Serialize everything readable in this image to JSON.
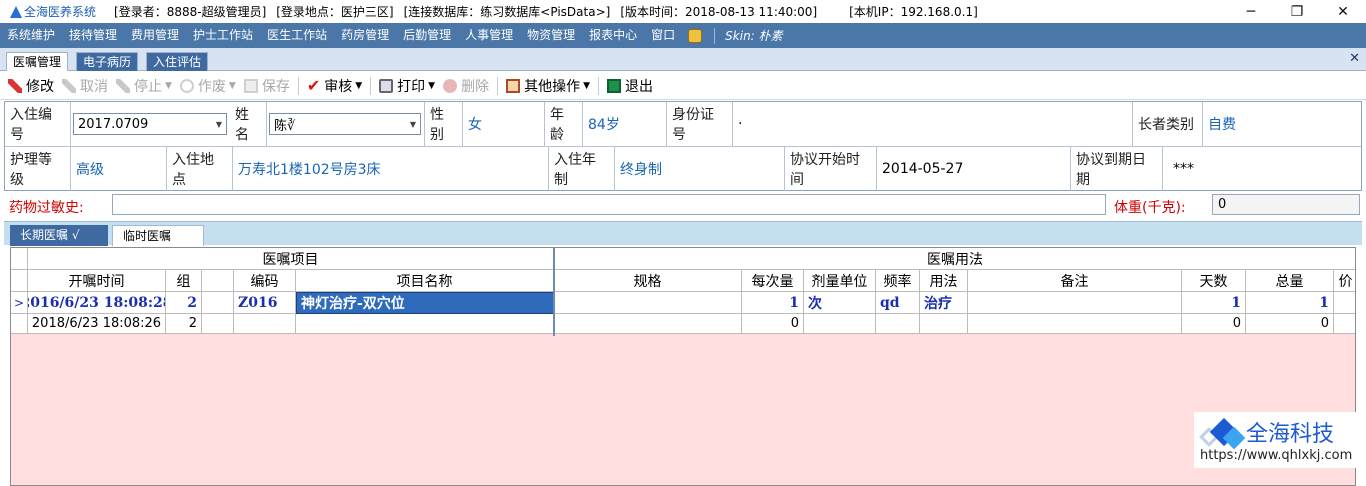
{
  "titlebar": {
    "app_name": "全海医养系统",
    "login_user": "[登录者：8888-超级管理员]",
    "login_place": "[登录地点：医护三区]",
    "database": "[连接数据库：练习数据库<PisData>]",
    "version_time": "[版本时间：2018-08-13 11:40:00]",
    "local_ip": "[本机IP：192.168.0.1]",
    "minimize": "─",
    "restore": "❐",
    "close": "✕"
  },
  "menubar": {
    "items": [
      "系统维护",
      "接待管理",
      "费用管理",
      "护士工作站",
      "医生工作站",
      "药房管理",
      "后勤管理",
      "人事管理",
      "物资管理",
      "报表中心",
      "窗口"
    ],
    "skin_label": "Skin: 朴素"
  },
  "outer_tabs": {
    "tabs": [
      "医嘱管理",
      "电子病历",
      "入住评估"
    ],
    "active_index": 0,
    "close_glyph": "✕"
  },
  "toolbar": {
    "buttons": [
      {
        "label": "修改",
        "enabled": true,
        "icon": "pencil-icon"
      },
      {
        "label": "取消",
        "enabled": false,
        "icon": "cancel-icon"
      },
      {
        "label": "停止",
        "enabled": false,
        "icon": "stop-icon",
        "dropdown": true
      },
      {
        "label": "作废",
        "enabled": false,
        "icon": "void-icon",
        "dropdown": true
      },
      {
        "label": "保存",
        "enabled": false,
        "icon": "save-icon"
      },
      {
        "label": "审核",
        "enabled": true,
        "icon": "check-icon",
        "dropdown": true
      },
      {
        "label": "打印",
        "enabled": true,
        "icon": "print-icon",
        "dropdown": true
      },
      {
        "label": "删除",
        "enabled": false,
        "icon": "delete-icon"
      },
      {
        "label": "其他操作",
        "enabled": true,
        "icon": "other-ops-icon",
        "dropdown": true
      },
      {
        "label": "退出",
        "enabled": true,
        "icon": "exit-icon"
      }
    ]
  },
  "patient": {
    "admission_no_label": "入住编号",
    "admission_no": "2017.0709",
    "name_label": "姓名",
    "name": "陈∛",
    "gender_label": "性别",
    "gender": "女",
    "age_label": "年龄",
    "age": "84岁",
    "id_label": "身份证号",
    "id_value": "·",
    "elder_type_label": "长者类别",
    "elder_type": "自费",
    "care_level_label": "护理等级",
    "care_level": "高级",
    "location_label": "入住地点",
    "location": "万寿北1楼102号房3床",
    "stay_type_label": "入住年制",
    "stay_type": "终身制",
    "agreement_start_label": "协议开始时间",
    "agreement_start": "2014-05-27",
    "agreement_end_label": "协议到期日期",
    "agreement_end": "***"
  },
  "allergy": {
    "label": "药物过敏史:",
    "value": "",
    "weight_label": "体重(千克):",
    "weight": "0"
  },
  "inner_tabs": {
    "long_term": "长期医嘱   √",
    "temporary": "临时医嘱"
  },
  "orders": {
    "group_item": "医嘱项目",
    "group_usage": "医嘱用法",
    "columns": [
      "开嘱时间",
      "组",
      "",
      "编码",
      "项目名称",
      "规格",
      "每次量",
      "剂量单位",
      "频率",
      "用法",
      "备注",
      "天数",
      "总量",
      "价"
    ],
    "rows": [
      {
        "marker": ">",
        "time": "2016/6/23 18:08:28",
        "group": "2",
        "flag": "",
        "code": "Z016",
        "name": "神灯治疗-双穴位",
        "spec": "",
        "dose": "1",
        "unit": "次",
        "freq": "qd",
        "usage": "治疗",
        "remark": "",
        "days": "1",
        "total": "1",
        "price": ""
      },
      {
        "marker": "",
        "time": "2018/6/23 18:08:26",
        "group": "2",
        "flag": "",
        "code": "",
        "name": "",
        "spec": "",
        "dose": "0",
        "unit": "",
        "freq": "",
        "usage": "",
        "remark": "",
        "days": "0",
        "total": "0",
        "price": ""
      }
    ]
  },
  "watermark": {
    "brand": "全海科技",
    "url": "https://www.qhlxkj.com"
  }
}
